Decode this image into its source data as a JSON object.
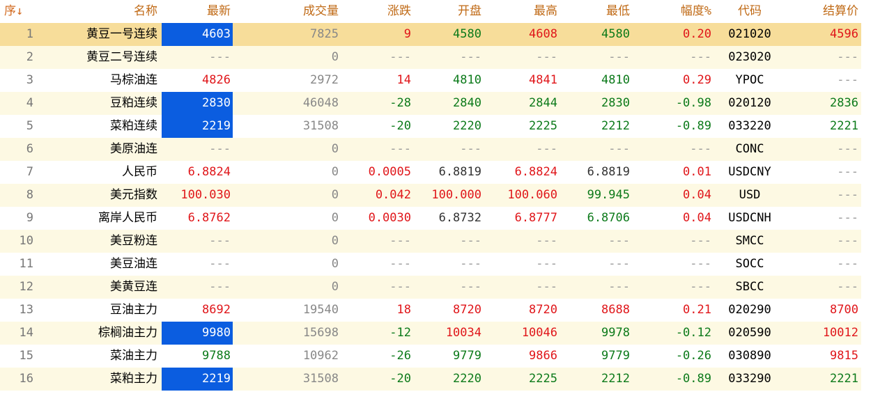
{
  "header": {
    "seq": "序↓",
    "name": "名称",
    "last": "最新",
    "volume": "成交量",
    "change": "涨跌",
    "open": "开盘",
    "high": "最高",
    "low": "最低",
    "pct": "幅度%",
    "code": "代码",
    "settle": "结算价"
  },
  "colors": {
    "up": "#e0161a",
    "down": "#0c7a1a",
    "highlight": "#0b5de0",
    "selected_row": "#f7dd9a",
    "alt_row": "#fdf9e3",
    "header_text": "#c06a16"
  },
  "rows": [
    {
      "seq": "1",
      "name": "黄豆一号连续",
      "last": "4603",
      "volume": "7825",
      "change": "9",
      "open": "4580",
      "high": "4608",
      "low": "4580",
      "pct": "0.20",
      "code": "021020",
      "settle": "4596"
    },
    {
      "seq": "2",
      "name": "黄豆二号连续",
      "last": "---",
      "volume": "0",
      "change": "---",
      "open": "---",
      "high": "---",
      "low": "---",
      "pct": "---",
      "code": "023020",
      "settle": "---"
    },
    {
      "seq": "3",
      "name": "马棕油连",
      "last": "4826",
      "volume": "2972",
      "change": "14",
      "open": "4810",
      "high": "4841",
      "low": "4810",
      "pct": "0.29",
      "code": "YPOC",
      "settle": "---"
    },
    {
      "seq": "4",
      "name": "豆粕连续",
      "last": "2830",
      "volume": "46048",
      "change": "-28",
      "open": "2840",
      "high": "2844",
      "low": "2830",
      "pct": "-0.98",
      "code": "020120",
      "settle": "2836"
    },
    {
      "seq": "5",
      "name": "菜粕连续",
      "last": "2219",
      "volume": "31508",
      "change": "-20",
      "open": "2220",
      "high": "2225",
      "low": "2212",
      "pct": "-0.89",
      "code": "033220",
      "settle": "2221"
    },
    {
      "seq": "6",
      "name": "美原油连",
      "last": "---",
      "volume": "0",
      "change": "---",
      "open": "---",
      "high": "---",
      "low": "---",
      "pct": "---",
      "code": "CONC",
      "settle": "---"
    },
    {
      "seq": "7",
      "name": "人民币",
      "last": "6.8824",
      "volume": "0",
      "change": "0.0005",
      "open": "6.8819",
      "high": "6.8824",
      "low": "6.8819",
      "pct": "0.01",
      "code": "USDCNY",
      "settle": "---"
    },
    {
      "seq": "8",
      "name": "美元指数",
      "last": "100.030",
      "volume": "0",
      "change": "0.042",
      "open": "100.000",
      "high": "100.060",
      "low": "99.945",
      "pct": "0.04",
      "code": "USD",
      "settle": "---"
    },
    {
      "seq": "9",
      "name": "离岸人民币",
      "last": "6.8762",
      "volume": "0",
      "change": "0.0030",
      "open": "6.8732",
      "high": "6.8777",
      "low": "6.8706",
      "pct": "0.04",
      "code": "USDCNH",
      "settle": "---"
    },
    {
      "seq": "10",
      "name": "美豆粉连",
      "last": "---",
      "volume": "0",
      "change": "---",
      "open": "---",
      "high": "---",
      "low": "---",
      "pct": "---",
      "code": "SMCC",
      "settle": "---"
    },
    {
      "seq": "11",
      "name": "美豆油连",
      "last": "---",
      "volume": "0",
      "change": "---",
      "open": "---",
      "high": "---",
      "low": "---",
      "pct": "---",
      "code": "SOCC",
      "settle": "---"
    },
    {
      "seq": "12",
      "name": "美黄豆连",
      "last": "---",
      "volume": "0",
      "change": "---",
      "open": "---",
      "high": "---",
      "low": "---",
      "pct": "---",
      "code": "SBCC",
      "settle": "---"
    },
    {
      "seq": "13",
      "name": "豆油主力",
      "last": "8692",
      "volume": "19540",
      "change": "18",
      "open": "8720",
      "high": "8720",
      "low": "8688",
      "pct": "0.21",
      "code": "020290",
      "settle": "8700"
    },
    {
      "seq": "14",
      "name": "棕榈油主力",
      "last": "9980",
      "volume": "15698",
      "change": "-12",
      "open": "10034",
      "high": "10046",
      "low": "9978",
      "pct": "-0.12",
      "code": "020590",
      "settle": "10012"
    },
    {
      "seq": "15",
      "name": "菜油主力",
      "last": "9788",
      "volume": "10962",
      "change": "-26",
      "open": "9779",
      "high": "9866",
      "low": "9779",
      "pct": "-0.26",
      "code": "030890",
      "settle": "9815"
    },
    {
      "seq": "16",
      "name": "菜粕主力",
      "last": "2219",
      "volume": "31508",
      "change": "-20",
      "open": "2220",
      "high": "2225",
      "low": "2212",
      "pct": "-0.89",
      "code": "033290",
      "settle": "2221"
    }
  ]
}
